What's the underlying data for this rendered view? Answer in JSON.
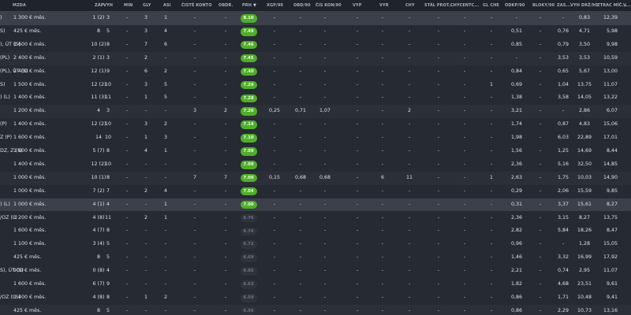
{
  "columns": [
    {
      "key": "name",
      "label": ""
    },
    {
      "key": "mzda",
      "label": "MZDA"
    },
    {
      "key": "zap",
      "label": "ZÁP"
    },
    {
      "key": "vyh",
      "label": "VYH"
    },
    {
      "key": "min",
      "label": "MIN"
    },
    {
      "key": "gly",
      "label": "GLY"
    },
    {
      "key": "asi",
      "label": "ASI"
    },
    {
      "key": "cisteKonto",
      "label": "ČISTÉ KONTO"
    },
    {
      "key": "obdr",
      "label": "OBDR."
    },
    {
      "key": "prh",
      "label": "PRH"
    },
    {
      "key": "xgp",
      "label": "XGP/90"
    },
    {
      "key": "obd90",
      "label": "OBD/90"
    },
    {
      "key": "ciskon",
      "label": "ČIS KON/90"
    },
    {
      "key": "vyp",
      "label": "VYP"
    },
    {
      "key": "vyr",
      "label": "VYR"
    },
    {
      "key": "chy",
      "label": "CHY"
    },
    {
      "key": "stalprot",
      "label": "STÁL PROT..."
    },
    {
      "key": "chycentr",
      "label": "CHYCENTC..."
    },
    {
      "key": "glche",
      "label": "GL CHE"
    },
    {
      "key": "odkp",
      "label": "ODKP/90"
    },
    {
      "key": "bloky",
      "label": "BLOKY/90"
    },
    {
      "key": "zas",
      "label": "ZAS..."
    },
    {
      "key": "vyhdz",
      "label": "VYH DRŽ/90"
    },
    {
      "key": "ztrac",
      "label": "ZTRAC MÍČ..."
    },
    {
      "key": "v",
      "label": "V..."
    }
  ],
  "sort_icon": "▼",
  "rows": [
    {
      "name": ")",
      "mzda": "1 300 € měs.",
      "zap": "1 (2)",
      "vyh": "3",
      "min": "-",
      "gly": "3",
      "asi": "1",
      "cisteKonto": "-",
      "obdr": "-",
      "prh": "8.10",
      "prhHi": true,
      "xgp": "-",
      "obd90": "-",
      "ciskon": "-",
      "vyp": "-",
      "vyr": "-",
      "chy": "-",
      "stalprot": "-",
      "chycentr": "-",
      "glche": "-",
      "odkp": "-",
      "bloky": "-",
      "zas": "-",
      "vyhdz": "0,83",
      "ztrac": "12,39",
      "style": "hl"
    },
    {
      "name": "S)",
      "mzda": "425 € měs.",
      "zap": "8",
      "vyh": "5",
      "min": "-",
      "gly": "3",
      "asi": "4",
      "cisteKonto": "-",
      "obdr": "-",
      "prh": "7.49",
      "prhHi": true,
      "xgp": "-",
      "obd90": "-",
      "ciskon": "-",
      "vyp": "-",
      "vyr": "-",
      "chy": "-",
      "stalprot": "-",
      "chycentr": "-",
      "glche": "-",
      "odkp": "0,51",
      "bloky": "-",
      "zas": "0,76",
      "vyhdz": "4,71",
      "ztrac": "5,98",
      "style": ""
    },
    {
      "name": "), ÚT (S)",
      "mzda": "1 600 € měs.",
      "zap": "10 (2)",
      "vyh": "8",
      "min": "-",
      "gly": "7",
      "asi": "6",
      "cisteKonto": "-",
      "obdr": "-",
      "prh": "7.46",
      "prhHi": true,
      "xgp": "-",
      "obd90": "-",
      "ciskon": "-",
      "vyp": "-",
      "vyr": "-",
      "chy": "-",
      "stalprot": "-",
      "chycentr": "-",
      "glche": "-",
      "odkp": "0,85",
      "bloky": "-",
      "zas": "0,79",
      "vyhdz": "3,50",
      "ztrac": "9,98",
      "style": ""
    },
    {
      "name": "(PL)",
      "mzda": "2 400 € měs.",
      "zap": "2 (1)",
      "vyh": "3",
      "min": "-",
      "gly": "2",
      "asi": "-",
      "cisteKonto": "-",
      "obdr": "-",
      "prh": "7.45",
      "prhHi": true,
      "xgp": "-",
      "obd90": "-",
      "ciskon": "-",
      "vyp": "-",
      "vyr": "-",
      "chy": "-",
      "stalprot": "-",
      "chycentr": "-",
      "glche": "-",
      "odkp": "-",
      "bloky": "-",
      "zas": "3,53",
      "vyhdz": "3,53",
      "ztrac": "10,59",
      "style": "alt"
    },
    {
      "name": "(PL), ÚT (S)",
      "mzda": "2 400 € měs.",
      "zap": "12 (1)",
      "vyh": "9",
      "min": "-",
      "gly": "6",
      "asi": "2",
      "cisteKonto": "-",
      "obdr": "-",
      "prh": "7.40",
      "prhHi": true,
      "xgp": "-",
      "obd90": "-",
      "ciskon": "-",
      "vyp": "-",
      "vyr": "-",
      "chy": "-",
      "stalprot": "-",
      "chycentr": "-",
      "glche": "-",
      "odkp": "0,84",
      "bloky": "-",
      "zas": "0,65",
      "vyhdz": "5,67",
      "ztrac": "13,00",
      "style": ""
    },
    {
      "name": "S)",
      "mzda": "1 500 € měs.",
      "zap": "12 (2)",
      "vyh": "10",
      "min": "-",
      "gly": "3",
      "asi": "5",
      "cisteKonto": "-",
      "obdr": "-",
      "prh": "7.29",
      "prhHi": true,
      "xgp": "-",
      "obd90": "-",
      "ciskon": "-",
      "vyp": "-",
      "vyr": "-",
      "chy": "-",
      "stalprot": "-",
      "chycentr": "-",
      "glche": "1",
      "odkp": "0,69",
      "bloky": "-",
      "zas": "1,04",
      "vyhdz": "13,75",
      "ztrac": "11,07",
      "style": ""
    },
    {
      "name": ") (L)",
      "mzda": "1 400 € měs.",
      "zap": "11 (3)",
      "vyh": "11",
      "min": "-",
      "gly": "1",
      "asi": "5",
      "cisteKonto": "-",
      "obdr": "-",
      "prh": "7.28",
      "prhHi": true,
      "xgp": "-",
      "obd90": "-",
      "ciskon": "-",
      "vyp": "-",
      "vyr": "-",
      "chy": "-",
      "stalprot": "-",
      "chycentr": "-",
      "glche": "-",
      "odkp": "1,38",
      "bloky": "-",
      "zas": "3,58",
      "vyhdz": "14,05",
      "ztrac": "13,22",
      "style": ""
    },
    {
      "name": "",
      "mzda": "1 200 € měs.",
      "zap": "4",
      "vyh": "3",
      "min": "-",
      "gly": "-",
      "asi": "-",
      "cisteKonto": "3",
      "obdr": "2",
      "prh": "7.20",
      "prhHi": true,
      "xgp": "0,25",
      "obd90": "0,71",
      "ciskon": "1,07",
      "vyp": "-",
      "vyr": "-",
      "chy": "2",
      "stalprot": "-",
      "chycentr": "-",
      "glche": "-",
      "odkp": "3,21",
      "bloky": "-",
      "zas": "-",
      "vyhdz": "2,86",
      "ztrac": "6,07",
      "style": "alt"
    },
    {
      "name": "(P)",
      "mzda": "1 400 € měs.",
      "zap": "12 (2)",
      "vyh": "10",
      "min": "-",
      "gly": "3",
      "asi": "2",
      "cisteKonto": "-",
      "obdr": "-",
      "prh": "7.14",
      "prhHi": true,
      "xgp": "-",
      "obd90": "-",
      "ciskon": "-",
      "vyp": "-",
      "vyr": "-",
      "chy": "-",
      "stalprot": "-",
      "chycentr": "-",
      "glche": "-",
      "odkp": "1,74",
      "bloky": "-",
      "zas": "0,87",
      "vyhdz": "4,83",
      "ztrac": "15,06",
      "style": ""
    },
    {
      "name": "Z (P)",
      "mzda": "1 600 € měs.",
      "zap": "14",
      "vyh": "10",
      "min": "-",
      "gly": "1",
      "asi": "3",
      "cisteKonto": "-",
      "obdr": "-",
      "prh": "7.10",
      "prhHi": true,
      "xgp": "-",
      "obd90": "-",
      "ciskon": "-",
      "vyp": "-",
      "vyr": "-",
      "chy": "-",
      "stalprot": "-",
      "chycentr": "-",
      "glche": "-",
      "odkp": "1,98",
      "bloky": "-",
      "zas": "6,03",
      "vyhdz": "22,89",
      "ztrac": "17,01",
      "style": ""
    },
    {
      "name": "DZ, Z (S)",
      "mzda": "1 600 € měs.",
      "zap": "5 (7)",
      "vyh": "8",
      "min": "-",
      "gly": "4",
      "asi": "1",
      "cisteKonto": "-",
      "obdr": "-",
      "prh": "7.09",
      "prhHi": true,
      "xgp": "-",
      "obd90": "-",
      "ciskon": "-",
      "vyp": "-",
      "vyr": "-",
      "chy": "-",
      "stalprot": "-",
      "chycentr": "-",
      "glche": "-",
      "odkp": "1,56",
      "bloky": "-",
      "zas": "1,25",
      "vyhdz": "14,69",
      "ztrac": "8,44",
      "style": ""
    },
    {
      "name": "",
      "mzda": "1 400 € měs.",
      "zap": "12 (2)",
      "vyh": "10",
      "min": "-",
      "gly": "-",
      "asi": "-",
      "cisteKonto": "-",
      "obdr": "-",
      "prh": "7.09",
      "prhHi": true,
      "xgp": "-",
      "obd90": "-",
      "ciskon": "-",
      "vyp": "-",
      "vyr": "-",
      "chy": "-",
      "stalprot": "-",
      "chycentr": "-",
      "glche": "-",
      "odkp": "2,36",
      "bloky": "-",
      "zas": "5,16",
      "vyhdz": "32,50",
      "ztrac": "14,85",
      "style": ""
    },
    {
      "name": "",
      "mzda": "1 000 € měs.",
      "zap": "10 (1)",
      "vyh": "8",
      "min": "-",
      "gly": "-",
      "asi": "-",
      "cisteKonto": "7",
      "obdr": "7",
      "prh": "7.09",
      "prhHi": true,
      "xgp": "0,15",
      "obd90": "0,68",
      "ciskon": "0,68",
      "vyp": "-",
      "vyr": "6",
      "chy": "11",
      "stalprot": "-",
      "chycentr": "-",
      "glche": "1",
      "odkp": "2,63",
      "bloky": "-",
      "zas": "1,75",
      "vyhdz": "10,03",
      "ztrac": "14,90",
      "style": "alt"
    },
    {
      "name": "",
      "mzda": "1 000 € měs.",
      "zap": "7 (2)",
      "vyh": "7",
      "min": "-",
      "gly": "2",
      "asi": "4",
      "cisteKonto": "-",
      "obdr": "-",
      "prh": "7.04",
      "prhHi": true,
      "xgp": "-",
      "obd90": "-",
      "ciskon": "-",
      "vyp": "-",
      "vyr": "-",
      "chy": "-",
      "stalprot": "-",
      "chycentr": "-",
      "glche": "-",
      "odkp": "0,29",
      "bloky": "-",
      "zas": "2,06",
      "vyhdz": "15,59",
      "ztrac": "9,85",
      "style": ""
    },
    {
      "name": ") (L)",
      "mzda": "1 000 € měs.",
      "zap": "4 (1)",
      "vyh": "4",
      "min": "-",
      "gly": "-",
      "asi": "1",
      "cisteKonto": "-",
      "obdr": "-",
      "prh": "7.00",
      "prhHi": true,
      "xgp": "-",
      "obd90": "-",
      "ciskon": "-",
      "vyp": "-",
      "vyr": "-",
      "chy": "-",
      "stalprot": "-",
      "chycentr": "-",
      "glche": "-",
      "odkp": "0,31",
      "bloky": "-",
      "zas": "3,37",
      "vyhdz": "15,61",
      "ztrac": "8,27",
      "style": "hl"
    },
    {
      "name": "/OZ (L)",
      "mzda": "1 200 € měs.",
      "zap": "4 (8)",
      "vyh": "11",
      "min": "-",
      "gly": "2",
      "asi": "1",
      "cisteKonto": "-",
      "obdr": "-",
      "prh": "6.76",
      "prhHi": false,
      "xgp": "-",
      "obd90": "-",
      "ciskon": "-",
      "vyp": "-",
      "vyr": "-",
      "chy": "-",
      "stalprot": "-",
      "chycentr": "-",
      "glche": "-",
      "odkp": "2,36",
      "bloky": "-",
      "zas": "3,15",
      "vyhdz": "8,27",
      "ztrac": "13,75",
      "style": ""
    },
    {
      "name": "",
      "mzda": "1 600 € měs.",
      "zap": "4 (7)",
      "vyh": "8",
      "min": "-",
      "gly": "-",
      "asi": "-",
      "cisteKonto": "-",
      "obdr": "-",
      "prh": "6.74",
      "prhHi": false,
      "xgp": "-",
      "obd90": "-",
      "ciskon": "-",
      "vyp": "-",
      "vyr": "-",
      "chy": "-",
      "stalprot": "-",
      "chycentr": "-",
      "glche": "-",
      "odkp": "2,82",
      "bloky": "-",
      "zas": "5,84",
      "vyhdz": "18,26",
      "ztrac": "8,47",
      "style": ""
    },
    {
      "name": "",
      "mzda": "1 100 € měs.",
      "zap": "3 (4)",
      "vyh": "5",
      "min": "-",
      "gly": "-",
      "asi": "-",
      "cisteKonto": "-",
      "obdr": "-",
      "prh": "6.72",
      "prhHi": false,
      "xgp": "-",
      "obd90": "-",
      "ciskon": "-",
      "vyp": "-",
      "vyr": "-",
      "chy": "-",
      "stalprot": "-",
      "chycentr": "-",
      "glche": "-",
      "odkp": "0,96",
      "bloky": "-",
      "zas": "-",
      "vyhdz": "1,28",
      "ztrac": "15,05",
      "style": ""
    },
    {
      "name": "",
      "mzda": "425 € měs.",
      "zap": "8",
      "vyh": "5",
      "min": "-",
      "gly": "-",
      "asi": "-",
      "cisteKonto": "-",
      "obdr": "-",
      "prh": "6.69",
      "prhHi": false,
      "xgp": "-",
      "obd90": "-",
      "ciskon": "-",
      "vyp": "-",
      "vyr": "-",
      "chy": "-",
      "stalprot": "-",
      "chycentr": "-",
      "glche": "-",
      "odkp": "1,46",
      "bloky": "-",
      "zas": "3,32",
      "vyhdz": "16,99",
      "ztrac": "17,92",
      "style": ""
    },
    {
      "name": "S), ÚT (S)",
      "mzda": "900 € měs.",
      "zap": "0 (8)",
      "vyh": "4",
      "min": "-",
      "gly": "-",
      "asi": "-",
      "cisteKonto": "-",
      "obdr": "-",
      "prh": "6.65",
      "prhHi": false,
      "xgp": "-",
      "obd90": "-",
      "ciskon": "-",
      "vyp": "-",
      "vyr": "-",
      "chy": "-",
      "stalprot": "-",
      "chycentr": "-",
      "glche": "-",
      "odkp": "2,21",
      "bloky": "-",
      "zas": "0,74",
      "vyhdz": "2,95",
      "ztrac": "11,07",
      "style": ""
    },
    {
      "name": "",
      "mzda": "1 600 € měs.",
      "zap": "6 (7)",
      "vyh": "9",
      "min": "-",
      "gly": "-",
      "asi": "-",
      "cisteKonto": "-",
      "obdr": "-",
      "prh": "6.63",
      "prhHi": false,
      "xgp": "-",
      "obd90": "-",
      "ciskon": "-",
      "vyp": "-",
      "vyr": "-",
      "chy": "-",
      "stalprot": "-",
      "chycentr": "-",
      "glche": "-",
      "odkp": "1,82",
      "bloky": "-",
      "zas": "4,68",
      "vyhdz": "23,51",
      "ztrac": "9,61",
      "style": ""
    },
    {
      "name": "/OZ (LS)",
      "mzda": "1 400 € měs.",
      "zap": "4 (8)",
      "vyh": "8",
      "min": "-",
      "gly": "1",
      "asi": "2",
      "cisteKonto": "-",
      "obdr": "-",
      "prh": "6.59",
      "prhHi": false,
      "xgp": "-",
      "obd90": "-",
      "ciskon": "-",
      "vyp": "-",
      "vyr": "-",
      "chy": "-",
      "stalprot": "-",
      "chycentr": "-",
      "glche": "-",
      "odkp": "0,86",
      "bloky": "-",
      "zas": "1,71",
      "vyhdz": "10,48",
      "ztrac": "9,41",
      "style": ""
    },
    {
      "name": "",
      "mzda": "425 € měs.",
      "zap": "8",
      "vyh": "5",
      "min": "-",
      "gly": "-",
      "asi": "-",
      "cisteKonto": "-",
      "obdr": "-",
      "prh": "6.56",
      "prhHi": false,
      "xgp": "-",
      "obd90": "-",
      "ciskon": "-",
      "vyp": "-",
      "vyr": "-",
      "chy": "-",
      "stalprot": "-",
      "chycentr": "-",
      "glche": "-",
      "odkp": "0,86",
      "bloky": "-",
      "zas": "2,29",
      "vyhdz": "10,73",
      "ztrac": "13,16",
      "style": "alt"
    }
  ]
}
